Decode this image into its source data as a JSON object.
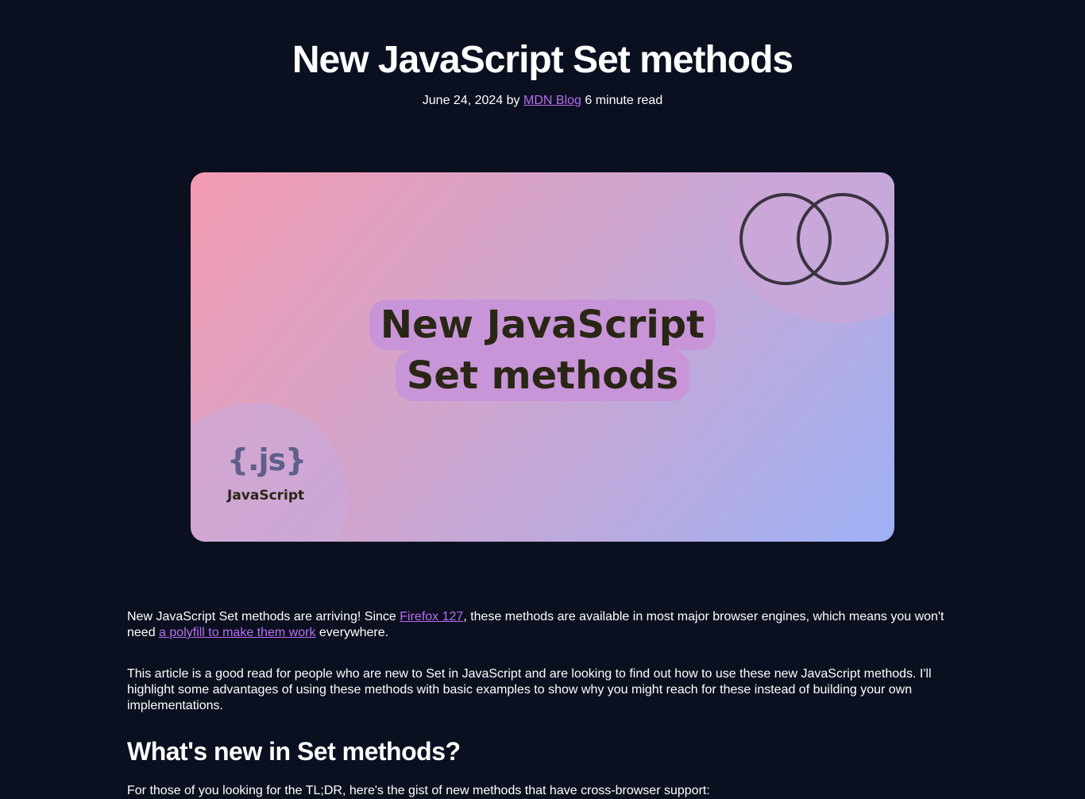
{
  "header": {
    "title": "New JavaScript Set methods",
    "date": "June 24, 2024",
    "by": "by",
    "author": "MDN Blog",
    "read_time": "6 minute read"
  },
  "hero": {
    "title_line1": "New JavaScript",
    "title_line2": "Set methods",
    "logo_text": "{.js}",
    "logo_label": "JavaScript",
    "icon": "venn-diagram-icon",
    "colors": {
      "gradient_start": "#f59cb2",
      "gradient_end": "#9db1f5",
      "title_bg": "#c896d8"
    }
  },
  "article": {
    "p1": {
      "before": "New JavaScript Set methods are arriving! Since ",
      "link1": "Firefox 127",
      "middle": ", these methods are available in most major browser engines, which means you won't need ",
      "link2": "a polyfill to make them work",
      "after": " everywhere."
    },
    "p2": "This article is a good read for people who are new to Set in JavaScript and are looking to find out how to use these new JavaScript methods. I'll highlight some advantages of using these methods with basic examples to show why you might reach for these instead of building your own implementations.",
    "h2": "What's new in Set methods?",
    "p3": "For those of you looking for the TL;DR, here's the gist of new methods that have cross-browser support:"
  },
  "colors": {
    "background": "#0b1020",
    "link": "#b86df0",
    "text": "#ffffff"
  }
}
